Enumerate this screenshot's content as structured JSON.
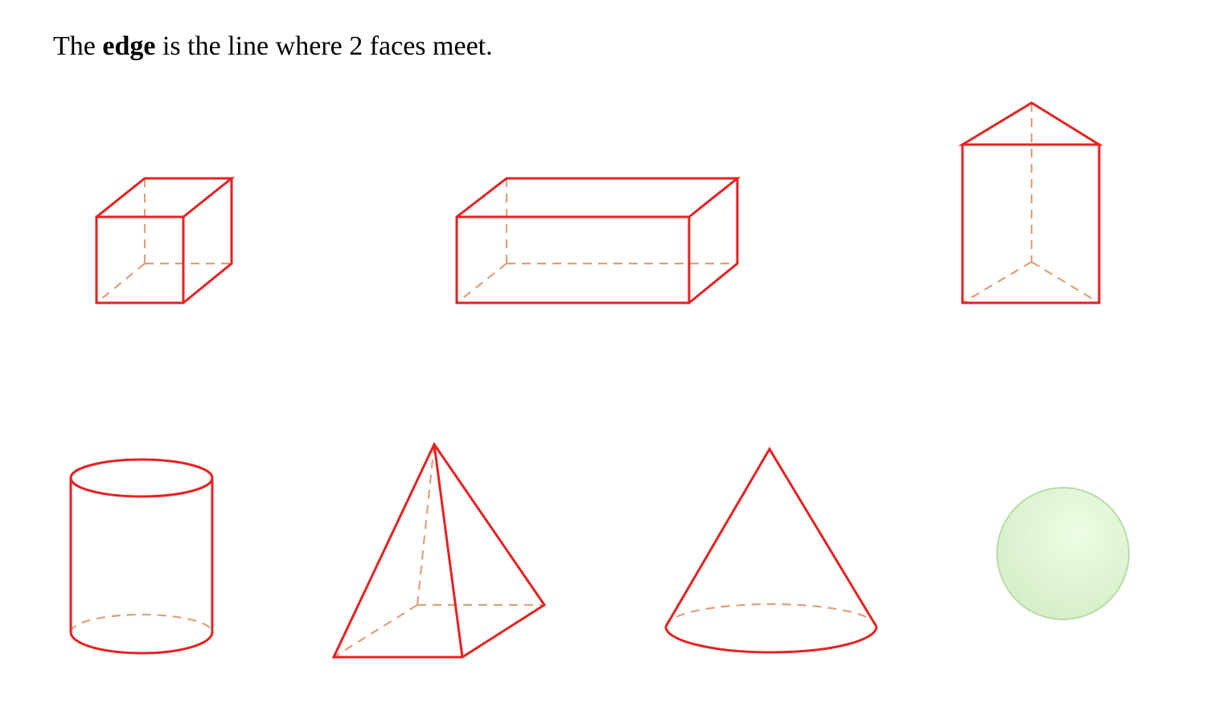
{
  "caption": {
    "prefix": "The ",
    "bold_word": "edge",
    "suffix": " is the line where 2 faces meet."
  },
  "shapes": [
    "cube",
    "cuboid",
    "triangular-prism",
    "cylinder",
    "square-pyramid",
    "cone",
    "sphere"
  ],
  "colors": {
    "edge": "#e52222",
    "hidden_edge": "#e0a07a",
    "sphere_fill": "#e4f7d8",
    "sphere_stroke": "#b8dca8"
  }
}
